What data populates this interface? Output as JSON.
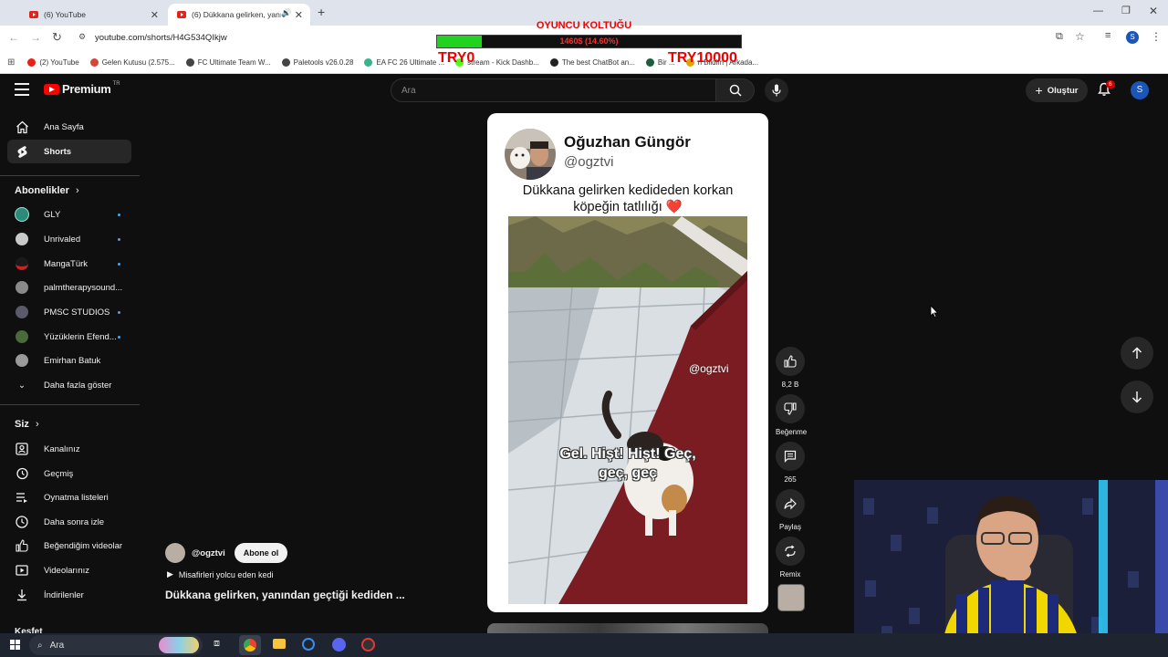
{
  "browser": {
    "tabs": [
      {
        "title": "(6) YouTube"
      },
      {
        "title": "(6) Dükkana gelirken, yanın"
      }
    ],
    "url": "youtube.com/shorts/H4G534QIkjw",
    "bookmarks": [
      {
        "label": "(2) YouTube",
        "color": "#e62117"
      },
      {
        "label": "Gelen Kutusu (2.575...",
        "color": "#d44638"
      },
      {
        "label": "FC Ultimate Team W...",
        "color": "#444444"
      },
      {
        "label": "Paletools v26.0.28",
        "color": "#444444"
      },
      {
        "label": "EA FC 26 Ultimate ...",
        "color": "#35b58c"
      },
      {
        "label": "stream - Kick Dashb...",
        "color": "#53fc18"
      },
      {
        "label": "The best ChatBot an...",
        "color": "#222222"
      },
      {
        "label": "Bir ...",
        "color": "#1b5e3b"
      },
      {
        "label": "n Bildim | Arkada...",
        "color": "#e6a100"
      }
    ]
  },
  "overlay": {
    "title": "OYUNCU KOLTUĞU",
    "progress_text": "1460$ (14.60%)",
    "progress": 0.146,
    "start_label": "TRY0",
    "goal_label": "TRY10000"
  },
  "header": {
    "logo_text": "Premium",
    "logo_badge": "TR",
    "search_placeholder": "Ara",
    "create_label": "Oluştur",
    "notif_count": "6",
    "account_initial": "S"
  },
  "sidebar": {
    "main": [
      {
        "label": "Ana Sayfa",
        "icon": "home-icon"
      },
      {
        "label": "Shorts",
        "icon": "shorts-icon"
      }
    ],
    "subs_heading": "Abonelikler",
    "subscriptions": [
      {
        "label": "GLY",
        "color": "#2a8b7a"
      },
      {
        "label": "Unrivaled",
        "color": "#c9c9c9"
      },
      {
        "label": "MangaTürk",
        "color": "#cc2222"
      },
      {
        "label": "palmtherapysound...",
        "color": "#8a8a8a"
      },
      {
        "label": "PMSC STUDIOS",
        "color": "#5a5a6a"
      },
      {
        "label": "Yüzüklerin Efend...",
        "color": "#4a6a3a"
      },
      {
        "label": "Emirhan Batuk",
        "color": "#9a9a9a"
      }
    ],
    "show_more": "Daha fazla göster",
    "you_heading": "Siz",
    "you_items": [
      {
        "label": "Kanalınız",
        "icon": "channel-icon"
      },
      {
        "label": "Geçmiş",
        "icon": "history-icon"
      },
      {
        "label": "Oynatma listeleri",
        "icon": "playlist-icon"
      },
      {
        "label": "Daha sonra izle",
        "icon": "clock-icon"
      },
      {
        "label": "Beğendiğim videolar",
        "icon": "like-icon"
      },
      {
        "label": "Videolarınız",
        "icon": "video-icon"
      },
      {
        "label": "İndirilenler",
        "icon": "download-icon"
      }
    ],
    "cut_heading": "Keşfet"
  },
  "short": {
    "author_name": "Oğuzhan Güngör",
    "author_handle": "@ogztvi",
    "caption_line1": "Dükkana gelirken kedideden korkan",
    "caption_line2": "köpeğin tatlılığı ❤️",
    "watermark": "@ogztvi",
    "subtitle_line1": "Gel. Hişt! Hişt! Geç,",
    "subtitle_line2": "geç, geç",
    "channel": "@ogztvi",
    "subscribe_label": "Abone ol",
    "sound_label": "Misafirleri yolcu eden kedi",
    "title": "Dükkana gelirken, yanından geçtiği kediden ..."
  },
  "actions": {
    "likes": "8,2 B",
    "dislike": "Beğenme",
    "comments": "265",
    "share": "Paylaş",
    "remix": "Remix"
  },
  "taskbar": {
    "search_placeholder": "Ara"
  }
}
